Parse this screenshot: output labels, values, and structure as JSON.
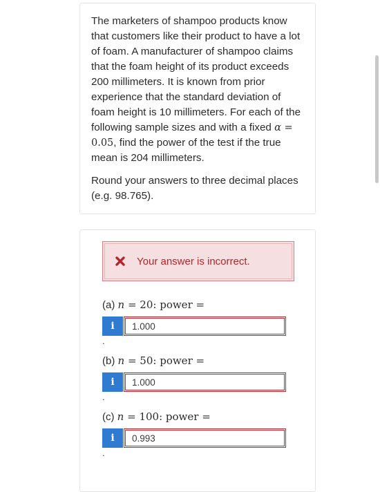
{
  "question": {
    "paragraph1_pre": "The marketers of shampoo products know that customers like their product to have a lot of foam. A manufacturer of shampoo claims that the foam height of its product exceeds 200 millimeters. It is known from prior experience that the standard deviation of foam height is 10 millimeters. For each of the following sample sizes and with a fixed",
    "alpha_symbol": "α",
    "alpha_eq": "= 0.05",
    "paragraph1_post": ", find the power of the test if the true mean is 204 millimeters.",
    "paragraph2": "Round your answers to three decimal places (e.g. 98.765)."
  },
  "feedback": {
    "message": "Your answer is incorrect.",
    "icon": "x-icon",
    "color": "#b3262d"
  },
  "parts": [
    {
      "label": "(a)",
      "n_symbol": "n",
      "expr": "= 20:  power  =",
      "value": "1.000",
      "dot": "."
    },
    {
      "label": "(b)",
      "n_symbol": "n",
      "expr": "= 50:  power  =",
      "value": "1.000",
      "dot": "."
    },
    {
      "label": "(c)",
      "n_symbol": "n",
      "expr": "= 100:  power  =",
      "value": "0.993",
      "dot": "."
    }
  ],
  "info_icon_label": "i",
  "colors": {
    "info": "#2e7bd1",
    "error_border": "#c0262d",
    "alert_bg": "#f5dfe0"
  }
}
